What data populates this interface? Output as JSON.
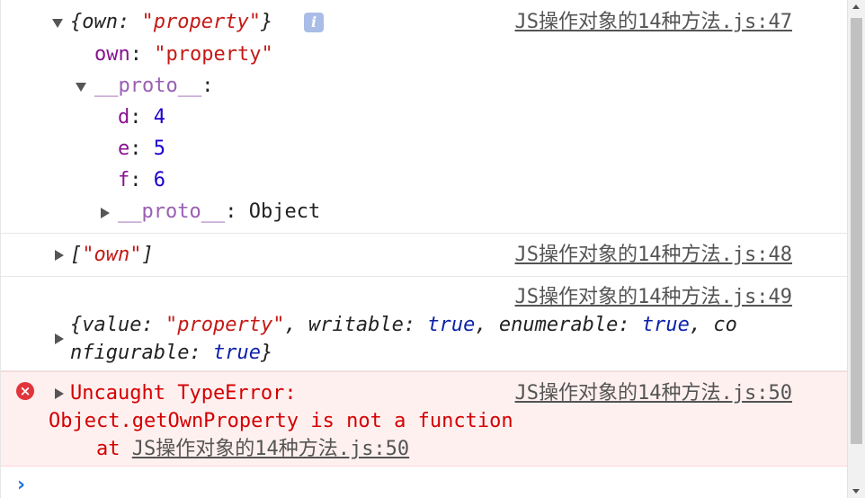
{
  "entries": [
    {
      "summary": {
        "open": "{",
        "key": "own",
        "sep": ": ",
        "value": "\"property\"",
        "close": "}"
      },
      "info_icon": "i",
      "source": "JS操作对象的14种方法.js:47",
      "children": {
        "own_key": "own",
        "own_sep": ": ",
        "own_value": "\"property\"",
        "proto_key": "__proto__",
        "proto_sep": ":",
        "props": [
          {
            "key": "d",
            "sep": ": ",
            "value": "4"
          },
          {
            "key": "e",
            "sep": ": ",
            "value": "5"
          },
          {
            "key": "f",
            "sep": ": ",
            "value": "6"
          }
        ],
        "inner_proto_key": "__proto__",
        "inner_proto_sep": ": ",
        "inner_proto_value": "Object"
      }
    },
    {
      "text_open": "[",
      "text_value": "\"own\"",
      "text_close": "]",
      "source": "JS操作对象的14种方法.js:48"
    },
    {
      "source": "JS操作对象的14种方法.js:49",
      "line1": {
        "open": "{",
        "k1": "value",
        "s1": ": ",
        "v1": "\"property\"",
        "c1": ", ",
        "k2": "writable",
        "s2": ": ",
        "v2": "true",
        "c2": ", ",
        "k3": "enumerable",
        "s3": ": ",
        "v3": "true",
        "c3": ", ",
        "k4a": "co"
      },
      "line2": {
        "k4b": "nfigurable",
        "s4": ": ",
        "v4": "true",
        "close": "}"
      }
    },
    {
      "error_icon": "×",
      "line1": "Uncaught TypeError:",
      "line2": "Object.getOwnProperty is not a function",
      "at_prefix": "    at ",
      "at_link": "JS操作对象的14种方法.js:50",
      "source": "JS操作对象的14种方法.js:50"
    }
  ],
  "prompt": "›",
  "colors": {
    "string": "#c41a16",
    "key": "#881391",
    "number": "#1c00cf",
    "keyword": "#0d22aa",
    "error_text": "#d40000",
    "error_bg": "#fff0f0",
    "error_icon": "#e0353b",
    "prompt": "#1a73e8"
  }
}
